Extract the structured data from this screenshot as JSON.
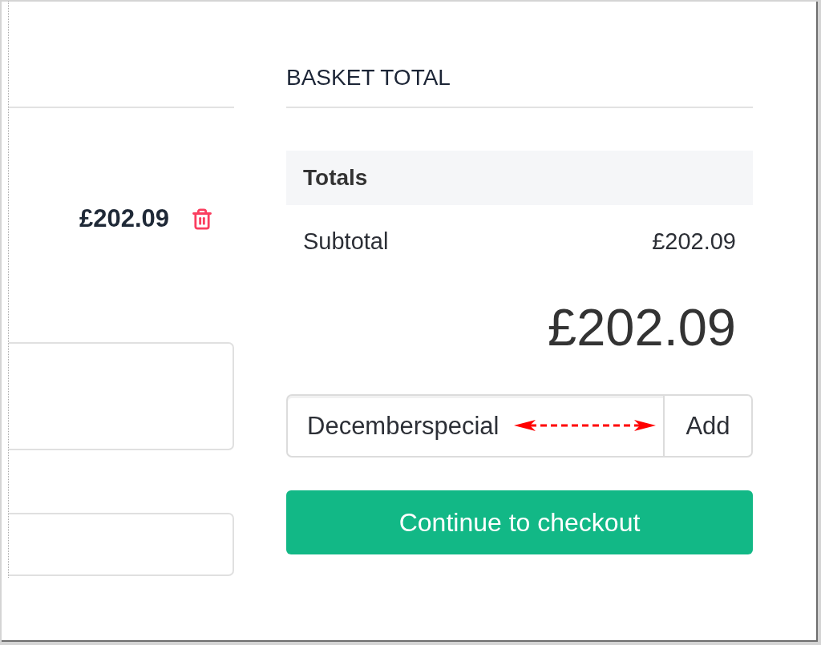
{
  "cart_item": {
    "price": "£202.09"
  },
  "basket_total": {
    "title": "BASKET TOTAL",
    "table_header": "Totals",
    "rows": [
      {
        "label": "Subtotal",
        "value": "£202.09"
      }
    ],
    "total": "£202.09",
    "coupon": {
      "value": "Decemberspecial",
      "button": "Add"
    },
    "checkout_button": "Continue to checkout"
  }
}
